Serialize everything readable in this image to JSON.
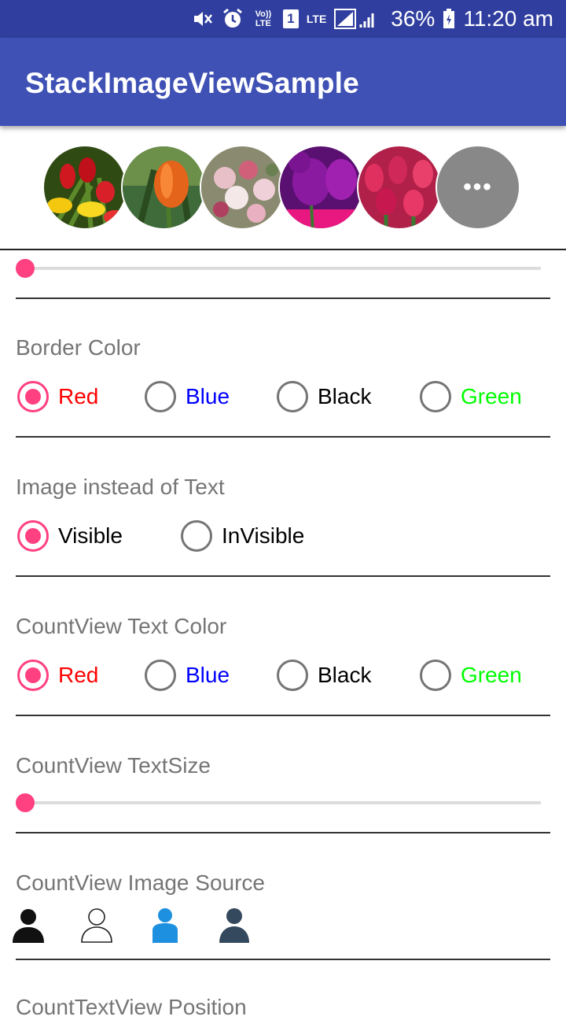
{
  "status_bar": {
    "volte": "Vo)) LTE",
    "sim": "1",
    "lte": "LTE",
    "battery": "36%",
    "time": "11:20 am",
    "icons": [
      "mute-icon",
      "alarm-icon",
      "volte-icon",
      "sim-icon",
      "signal-icon",
      "battery-icon"
    ]
  },
  "app_bar": {
    "title": "StackImageViewSample"
  },
  "stack_preview": {
    "images": [
      "yellow-red-tulips",
      "orange-tulip",
      "flower-bouquet",
      "purple-tulips",
      "pink-tulips"
    ],
    "more_label": "•••",
    "more_color": "#888888"
  },
  "sliders": {
    "top": {
      "value_fraction": 0
    },
    "countview_textsize": {
      "value_fraction": 0
    }
  },
  "border_color": {
    "label": "Border Color",
    "options": [
      {
        "label": "Red",
        "color": "#ff0000",
        "checked": true
      },
      {
        "label": "Blue",
        "color": "#0000ff",
        "checked": false
      },
      {
        "label": "Black",
        "color": "#000000",
        "checked": false
      },
      {
        "label": "Green",
        "color": "#00ff00",
        "checked": false
      }
    ]
  },
  "image_instead_of_text": {
    "label": "Image instead of Text",
    "options": [
      {
        "label": "Visible",
        "checked": true
      },
      {
        "label": "InVisible",
        "checked": false
      }
    ]
  },
  "countview_text_color": {
    "label": "CountView Text Color",
    "options": [
      {
        "label": "Red",
        "color": "#ff0000",
        "checked": true
      },
      {
        "label": "Blue",
        "color": "#0000ff",
        "checked": false
      },
      {
        "label": "Black",
        "color": "#000000",
        "checked": false
      },
      {
        "label": "Green",
        "color": "#00ff00",
        "checked": false
      }
    ]
  },
  "countview_textsize": {
    "label": "CountView TextSize"
  },
  "countview_image_source": {
    "label": "CountView Image Source",
    "icons": [
      "person-black-icon",
      "person-outline-icon",
      "person-blue-icon",
      "person-dark-blue-icon"
    ]
  },
  "count_textview_position": {
    "label": "CountTextView Position"
  },
  "colors": {
    "accent": "#ff4081",
    "primary": "#3f51b5",
    "primary_dark": "#303f9f"
  }
}
